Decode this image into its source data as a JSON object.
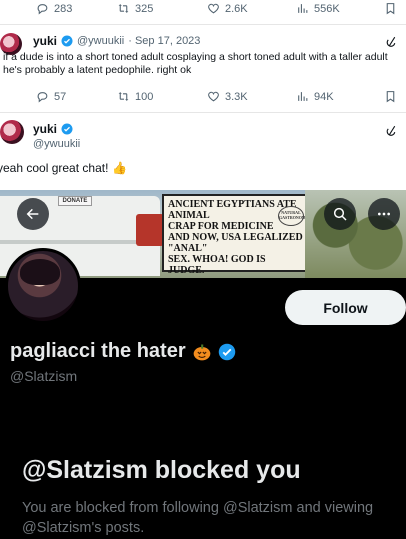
{
  "tweet_top_actions": {
    "replies": "283",
    "retweets": "325",
    "likes": "2.6K",
    "views": "556K"
  },
  "tweet1": {
    "display_name": "yuki",
    "handle": "@ywuukii",
    "date": "· Sep 17, 2023",
    "text": "if a dude is into a short toned adult cosplaying a short toned adult with a taller adult he's probably a latent pedophile. right ok",
    "actions": {
      "replies": "57",
      "retweets": "100",
      "likes": "3.3K",
      "views": "94K"
    }
  },
  "tweet2": {
    "display_name": "yuki",
    "handle": "@ywuukii",
    "text": "yeah cool great chat!",
    "emoji": "👍"
  },
  "banner": {
    "donate_label": "DONATE",
    "sign_lines": [
      "Ancient Egyptians ate animal",
      "crap for medicine",
      "And now, USA legalized \"anal\"",
      "sex. Whoa!    God is judge."
    ],
    "sign_badge": "Natural Gastronomy"
  },
  "profile": {
    "follow_label": "Follow",
    "name": "pagliacci the hater",
    "handle": "@Slatzism",
    "blocked_title": "@Slatzism blocked you",
    "blocked_text": "You are blocked from following @Slatzism and viewing @Slatzism's posts."
  },
  "colors": {
    "verified": "#1d9bf0",
    "muted": "#536471",
    "dark_bg": "#000000"
  }
}
